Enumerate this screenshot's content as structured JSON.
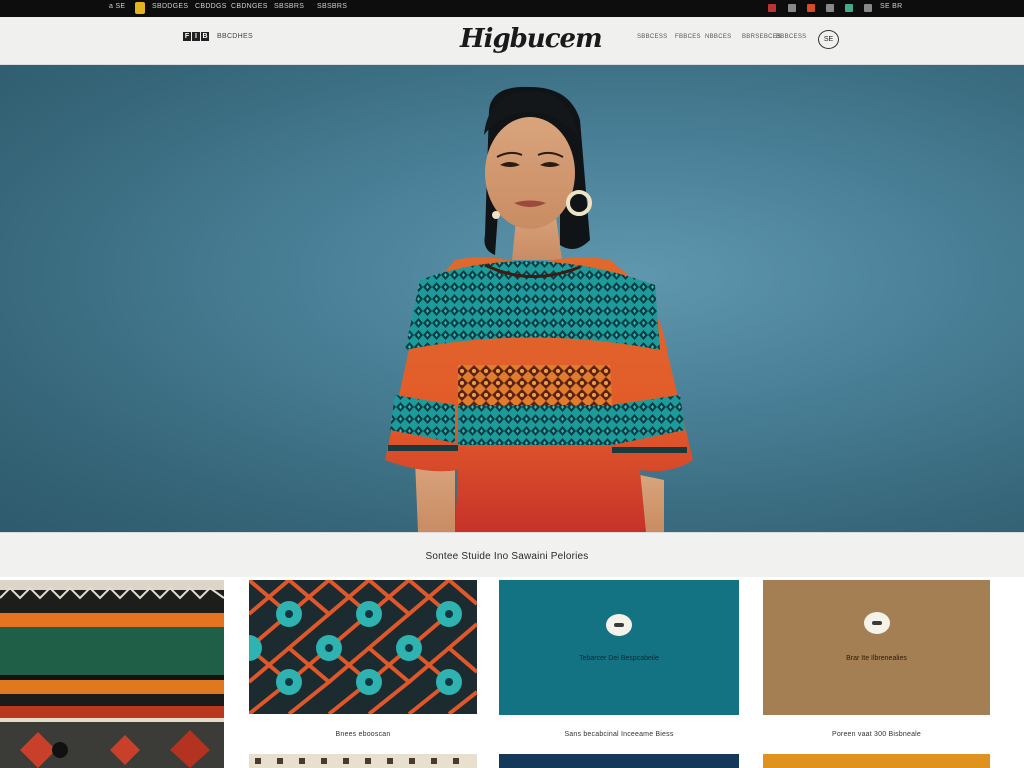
{
  "topbar": {
    "left_items": [
      "a SE",
      "SBDDGES",
      "CBDDGS",
      "CBDNGES",
      "SBSBRS"
    ],
    "right_label": "SE BR"
  },
  "header": {
    "social_icons": [
      "F",
      "I",
      "B"
    ],
    "social_label": "BBCDHES",
    "logo": "Higbucem",
    "nav": [
      "SBBCESS",
      "FBBCES",
      "NBBCES",
      "BBRSEBCES",
      "BBBCESS"
    ],
    "account_label": "SE"
  },
  "section": {
    "title": "Sontee Stuide Ino Sawaini Pelories"
  },
  "cards": [
    {
      "caption": "",
      "inner_text": ""
    },
    {
      "caption": "Bnees ebooscan",
      "inner_text": ""
    },
    {
      "caption": "Sans becabcinal Inceeame Biess",
      "inner_text": "Tebarcer Dei Bespcabeile"
    },
    {
      "caption": "Poreen vaat 300 Bisbneale",
      "inner_text": "Brar Ite Ilbrenealies"
    }
  ],
  "colors": {
    "hero_bg": "#4a8198",
    "teal_card": "#137383",
    "tan_card": "#a47f53",
    "accent_yellow": "#e3b421"
  }
}
